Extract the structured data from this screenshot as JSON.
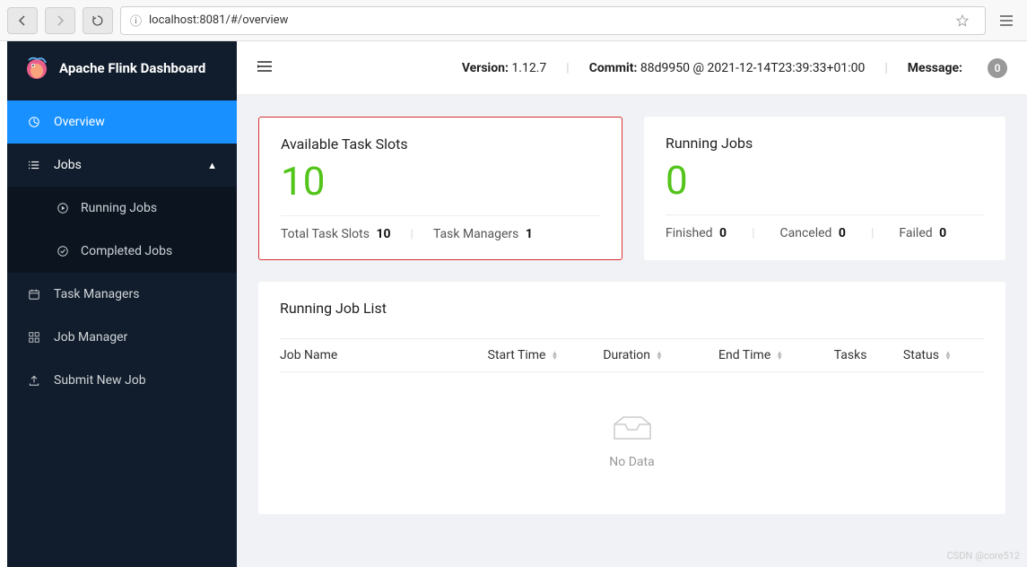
{
  "browser": {
    "url": "localhost:8081/#/overview"
  },
  "app": {
    "title": "Apache Flink Dashboard"
  },
  "nav": {
    "overview": "Overview",
    "jobs": "Jobs",
    "running_jobs": "Running Jobs",
    "completed_jobs": "Completed Jobs",
    "task_managers": "Task Managers",
    "job_manager": "Job Manager",
    "submit_new_job": "Submit New Job"
  },
  "header": {
    "version_label": "Version:",
    "version": "1.12.7",
    "commit_label": "Commit:",
    "commit": "88d9950 @ 2021-12-14T23:39:33+01:00",
    "message_label": "Message:",
    "message_count": "0"
  },
  "slots": {
    "title": "Available Task Slots",
    "value": "10",
    "total_label": "Total Task Slots",
    "total_value": "10",
    "tm_label": "Task Managers",
    "tm_value": "1"
  },
  "jobs": {
    "title": "Running Jobs",
    "value": "0",
    "finished_label": "Finished",
    "finished_value": "0",
    "canceled_label": "Canceled",
    "canceled_value": "0",
    "failed_label": "Failed",
    "failed_value": "0"
  },
  "job_list": {
    "title": "Running Job List",
    "columns": {
      "job_name": "Job Name",
      "start_time": "Start Time",
      "duration": "Duration",
      "end_time": "End Time",
      "tasks": "Tasks",
      "status": "Status"
    },
    "no_data": "No Data"
  },
  "watermark": "CSDN @core512"
}
